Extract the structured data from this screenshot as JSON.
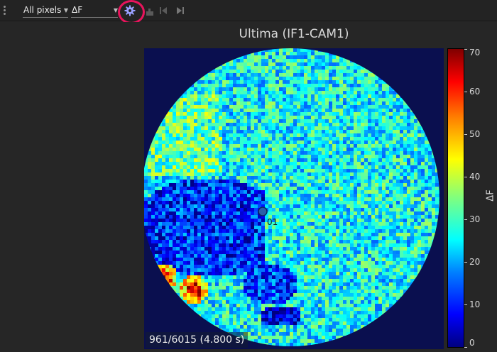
{
  "toolbar": {
    "pixel_selector": "All pixels",
    "signal_selector": "ΔF",
    "icons": [
      "kebab-menu-icon",
      "gear-icon",
      "thumbnail-icon",
      "step-back-icon",
      "step-forward-icon"
    ],
    "highlight_color": "#e8145c"
  },
  "plot": {
    "title": "Ultima (IF1-CAM1)",
    "roi_label": "01",
    "frame_label": "961/6015 (4.800 s)"
  },
  "colorbar": {
    "label": "ΔF",
    "ticks": [
      "70",
      "60",
      "50",
      "40",
      "30",
      "20",
      "10",
      "0"
    ],
    "colormap": "jet"
  },
  "chart_data": {
    "type": "heatmap",
    "title": "Ultima (IF1-CAM1)",
    "colorbar_label": "ΔF",
    "colorbar_range": [
      0,
      70
    ],
    "colorbar_ticks": [
      0,
      10,
      20,
      30,
      40,
      50,
      60,
      70
    ],
    "colormap": "jet",
    "annotations": [
      "01",
      "961/6015 (4.800 s)"
    ]
  }
}
